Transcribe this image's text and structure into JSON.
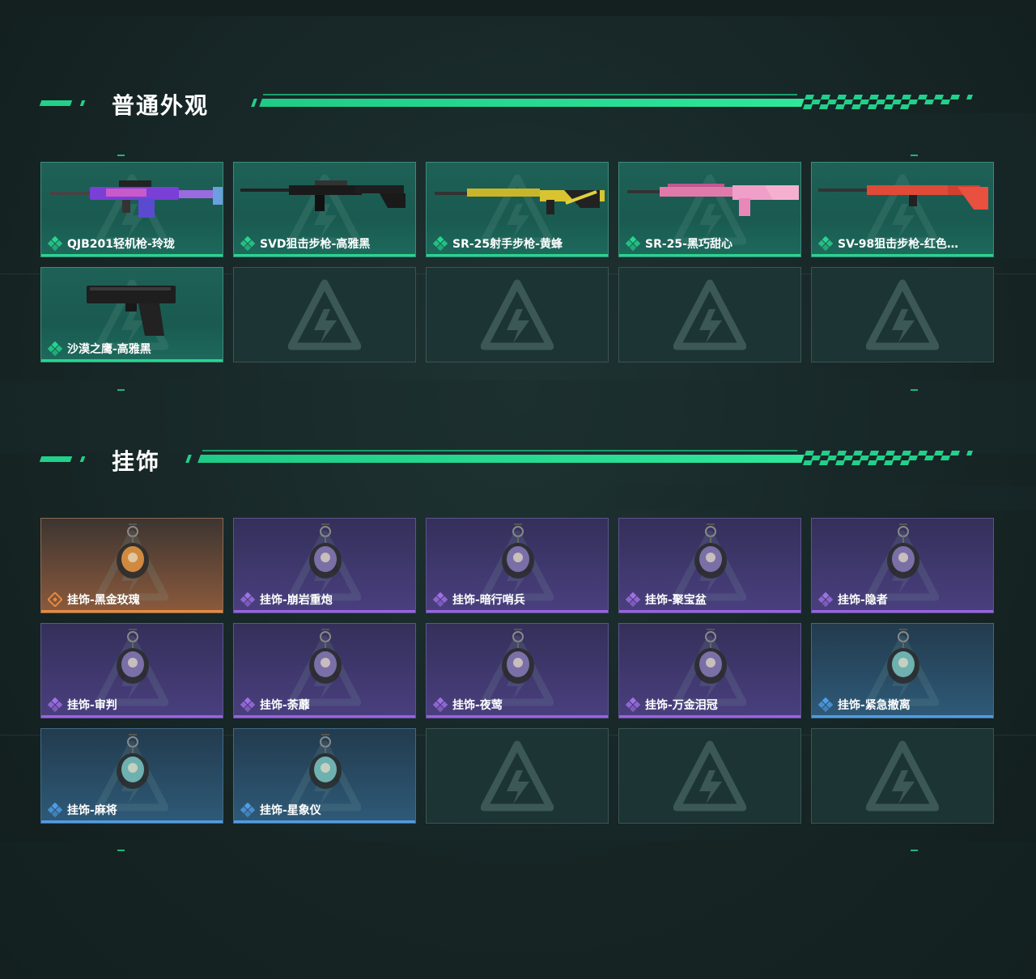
{
  "colors": {
    "accent": "#22d08a",
    "rarity_green": "#26d68e",
    "rarity_purple": "#9a63e0",
    "rarity_orange": "#e88a3e",
    "rarity_blue": "#4f9de6"
  },
  "sections": [
    {
      "title": "普通外观",
      "items": [
        {
          "label": "QJB201轻机枪-玲珑",
          "rarity": "green",
          "icon": "rifle-skin-image"
        },
        {
          "label": "SVD狙击步枪-高雅黑",
          "rarity": "green",
          "icon": "sniper-skin-image"
        },
        {
          "label": "SR-25射手步枪-黄蜂",
          "rarity": "green",
          "icon": "marksman-rifle-skin-image"
        },
        {
          "label": "SR-25-黑巧甜心",
          "rarity": "green",
          "icon": "rifle-skin-image"
        },
        {
          "label": "SV-98狙击步枪-红色…",
          "rarity": "green",
          "icon": "sniper-skin-image"
        },
        {
          "label": "沙漠之鹰-高雅黑",
          "rarity": "green",
          "icon": "pistol-skin-image"
        }
      ]
    },
    {
      "title": "挂饰",
      "items": [
        {
          "label": "挂饰-黑金玫瑰",
          "rarity": "orange",
          "icon": "charm-image"
        },
        {
          "label": "挂饰-崩岩重炮",
          "rarity": "purple",
          "icon": "charm-image"
        },
        {
          "label": "挂饰-暗行哨兵",
          "rarity": "purple",
          "icon": "charm-image"
        },
        {
          "label": "挂饰-聚宝盆",
          "rarity": "purple",
          "icon": "charm-image"
        },
        {
          "label": "挂饰-隐者",
          "rarity": "purple",
          "icon": "charm-image"
        },
        {
          "label": "挂饰-审判",
          "rarity": "purple",
          "icon": "charm-image"
        },
        {
          "label": "挂饰-荼蘼",
          "rarity": "purple",
          "icon": "charm-image"
        },
        {
          "label": "挂饰-夜莺",
          "rarity": "purple",
          "icon": "charm-image"
        },
        {
          "label": "挂饰-万金泪冠",
          "rarity": "purple",
          "icon": "charm-image"
        },
        {
          "label": "挂饰-紧急撤离",
          "rarity": "blue",
          "icon": "charm-image"
        },
        {
          "label": "挂饰-麻将",
          "rarity": "blue",
          "icon": "charm-image"
        },
        {
          "label": "挂饰-星象仪",
          "rarity": "blue",
          "icon": "charm-image"
        }
      ]
    }
  ]
}
